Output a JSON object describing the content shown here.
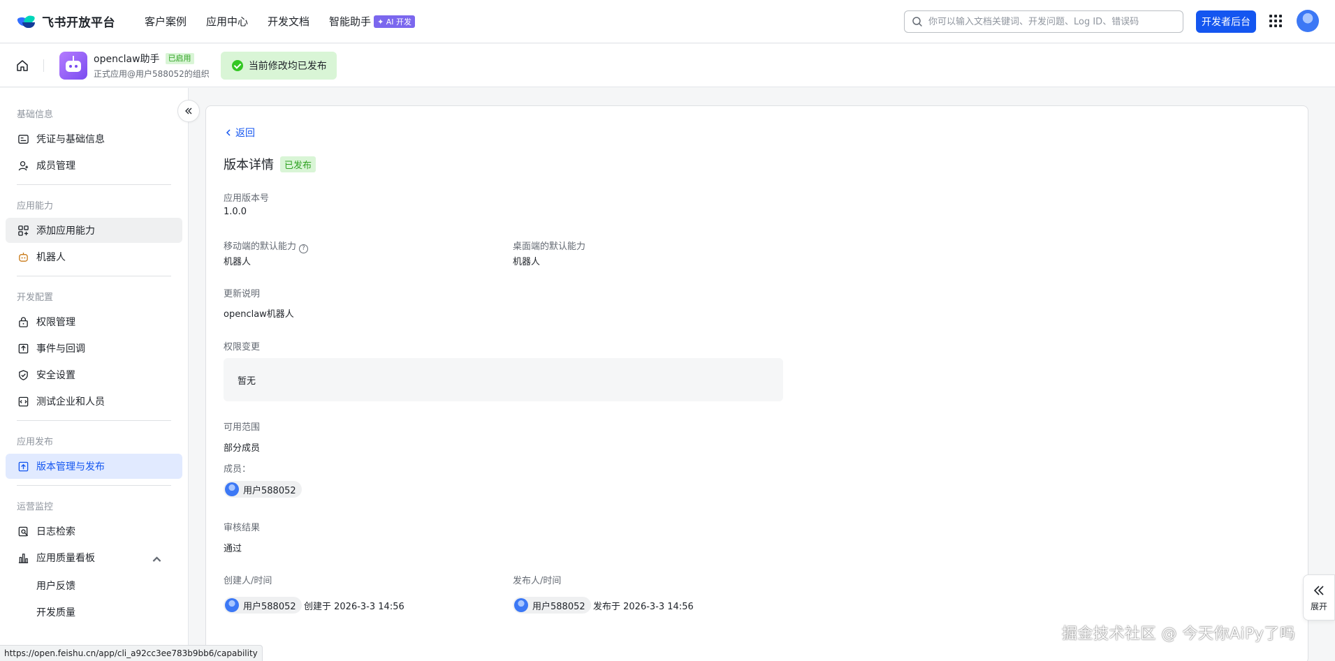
{
  "topnav": {
    "logo_text": "飞书开放平台",
    "links": [
      "客户案例",
      "应用中心",
      "开发文档",
      "智能助手"
    ],
    "ai_badge": "✦ AI 开发",
    "search_placeholder": "你可以输入文档关键词、开发问题、Log ID、错误码",
    "dev_console": "开发者后台"
  },
  "subbar": {
    "app_name": "openclaw助手",
    "app_status": "已启用",
    "app_subtitle": "正式应用@用户588052的组织",
    "banner": "当前修改均已发布"
  },
  "sidebar": {
    "sections": {
      "basic": "基础信息",
      "capability": "应用能力",
      "dev_config": "开发配置",
      "publish": "应用发布",
      "monitor": "运营监控"
    },
    "items": {
      "credentials": "凭证与基础信息",
      "members": "成员管理",
      "add_capability": "添加应用能力",
      "bot": "机器人",
      "permissions": "权限管理",
      "events": "事件与回调",
      "security": "安全设置",
      "test_org": "测试企业和人员",
      "version": "版本管理与发布",
      "log_search": "日志检索",
      "quality_board": "应用质量看板",
      "feedback": "用户反馈",
      "dev_quality": "开发质量"
    }
  },
  "main": {
    "back": "返回",
    "title": "版本详情",
    "title_tag": "已发布",
    "version_label": "应用版本号",
    "version_value": "1.0.0",
    "mobile_label": "移动端的默认能力",
    "mobile_help": "?",
    "mobile_value": "机器人",
    "desktop_label": "桌面端的默认能力",
    "desktop_value": "机器人",
    "notes_label": "更新说明",
    "notes_value": "openclaw机器人",
    "perm_label": "权限变更",
    "perm_value": "暂无",
    "scope_label": "可用范围",
    "scope_value": "部分成员",
    "members_label": "成员：",
    "member_name": "用户588052",
    "review_label": "审核结果",
    "review_value": "通过",
    "creator_label": "创建人/时间",
    "creator_name": "用户588052",
    "creator_time": "创建于 2026-3-3 14:56",
    "publisher_label": "发布人/时间",
    "publisher_name": "用户588052",
    "publisher_time": "发布于 2026-3-3 14:56"
  },
  "float": {
    "expand": "展开"
  },
  "watermark": "掘金技术社区 @ 今天你AiPy了吗",
  "status_url": "https://open.feishu.cn/app/cli_a92cc3ee783b9bb6/capability",
  "colors": {
    "brand_blue": "#1456f0",
    "success_green": "#2ea121",
    "success_bg": "#d9f5d6",
    "active_bg": "#e1eaff"
  },
  "icons": [
    "search-icon",
    "apps-grid-icon",
    "home-icon",
    "robot-icon",
    "check-icon",
    "collapse-left-icon",
    "credential-icon",
    "member-icon",
    "add-capability-icon",
    "bot-icon",
    "lock-icon",
    "event-icon",
    "shield-icon",
    "test-org-icon",
    "upload-icon",
    "log-search-icon",
    "chart-icon",
    "chevron-up-icon",
    "chevron-left-icon",
    "expand-icon"
  ]
}
